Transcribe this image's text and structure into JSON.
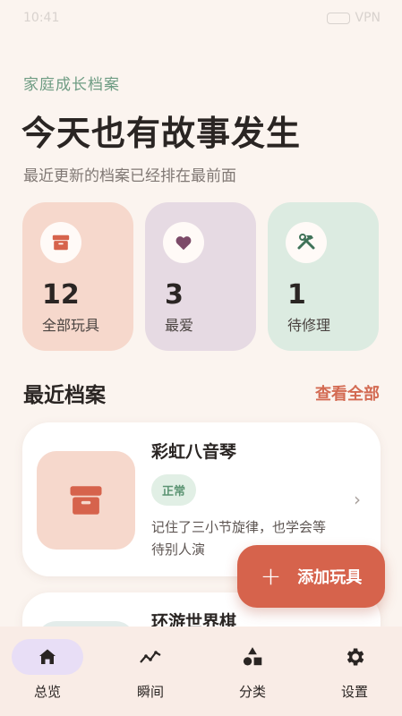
{
  "status_bar": {
    "time": "10:41",
    "right": "VPN"
  },
  "header": {
    "eyebrow": "家庭成长档案",
    "title": "今天也有故事发生",
    "subtitle": "最近更新的档案已经排在最前面"
  },
  "stats": [
    {
      "value": "12",
      "label": "全部玩具",
      "icon": "box-icon",
      "color": "#f6d8cc"
    },
    {
      "value": "3",
      "label": "最爱",
      "icon": "heart-icon",
      "color": "#e6dae3"
    },
    {
      "value": "1",
      "label": "待修理",
      "icon": "tools-icon",
      "color": "#dcebe1"
    }
  ],
  "section": {
    "title": "最近档案",
    "see_all": "查看全部"
  },
  "records": [
    {
      "name": "彩虹八音琴",
      "badge": "正常",
      "desc": "记住了三小节旋律，也学会等待别人演"
    },
    {
      "name": "环游世界棋"
    }
  ],
  "fab": {
    "label": "添加玩具",
    "icon": "plus-icon"
  },
  "nav": [
    {
      "label": "总览",
      "icon": "home-icon",
      "active": true
    },
    {
      "label": "瞬间",
      "icon": "trend-icon",
      "active": false
    },
    {
      "label": "分类",
      "icon": "shapes-icon",
      "active": false
    },
    {
      "label": "设置",
      "icon": "gear-icon",
      "active": false
    }
  ],
  "colors": {
    "accent": "#d6634c",
    "green": "#6e9c83",
    "background": "#fbf4ef"
  }
}
